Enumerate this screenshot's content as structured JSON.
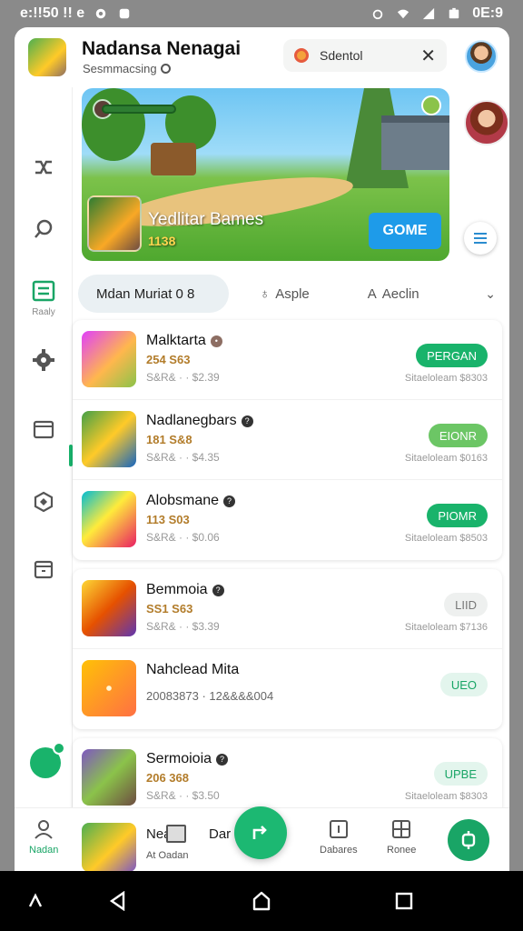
{
  "status_bar": {
    "time_left": "e:!!50 !! e",
    "time_right": "0E:9"
  },
  "header": {
    "title": "Nadansa Nenagai",
    "subtitle": "Sesmmacsing",
    "search_chip": {
      "text": "Sdentol"
    }
  },
  "banner": {
    "title": "Yedlitar Bames",
    "count": "1138",
    "button_label": "GOME"
  },
  "rail": {
    "active_label": "Raaly"
  },
  "tabs": [
    {
      "label": "Mdan Muriat 0 8"
    },
    {
      "label": "Asple"
    },
    {
      "label": "Aeclin"
    }
  ],
  "games": [
    {
      "title": "Malktarta",
      "stat": "254 S63",
      "meta": "S&R& · · $2.39",
      "action": "PERGAN",
      "sub": "Sitaeloleam $8303",
      "style": "green"
    },
    {
      "title": "Nadlanegbars",
      "stat": "181 S&8",
      "meta": "S&R& · · $4.35",
      "action": "EIONR",
      "sub": "Sitaeloleam $0163",
      "style": "lightgreen"
    },
    {
      "title": "Alobsmane",
      "stat": "113 S03",
      "meta": "S&R& · · $0.06",
      "action": "PIOMR",
      "sub": "Sitaeloleam $8503",
      "style": "green"
    },
    {
      "title": "Bemmoia",
      "stat": "SS1 S63",
      "meta": "S&R& · · $3.39",
      "action": "LIID",
      "sub": "Sitaeloleam $7136",
      "style": "grey"
    },
    {
      "title": "Nahclead Mita",
      "stat": "20083873 · 12&&&&004",
      "meta": "",
      "action": "UEO",
      "sub": "",
      "style": "mint"
    },
    {
      "title": "Sermoioia",
      "stat": "206 368",
      "meta": "S&R& · · $3.50",
      "action": "UPBE",
      "sub": "Sitaeloleam $8303",
      "style": "mint"
    }
  ],
  "bottom_nav": {
    "home_label": "Nadan",
    "item2_title": "Nea",
    "item2_label": "At Oadan",
    "item3_title": "Dar",
    "item4_label": "Dabares",
    "item5_label": "Ronee"
  }
}
